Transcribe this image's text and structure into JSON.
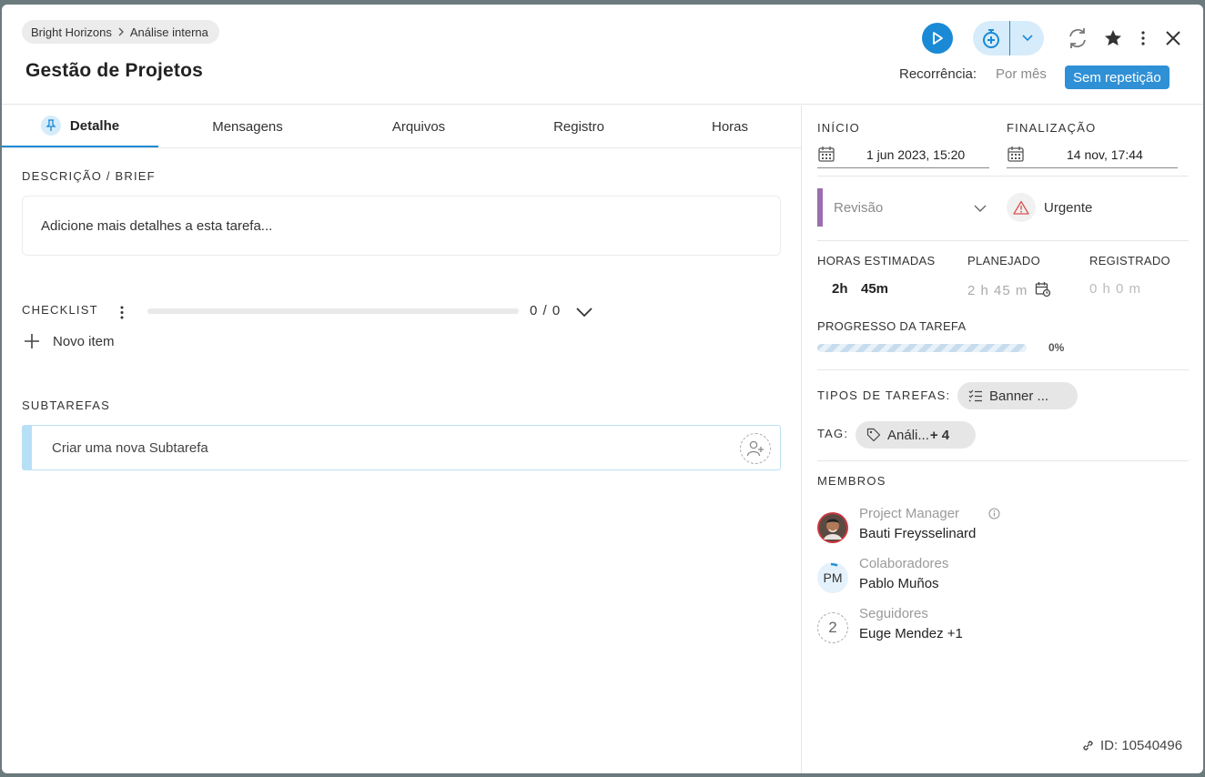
{
  "breadcrumb": {
    "workspace": "Bright Horizons",
    "project": "Análise interna"
  },
  "title": "Gestão de Projetos",
  "recurrence": {
    "label": "Recorrência:",
    "value": "Por mês",
    "badge": "Sem repetição"
  },
  "tabs": [
    "Detalhe",
    "Mensagens",
    "Arquivos",
    "Registro",
    "Horas"
  ],
  "description": {
    "label": "DESCRIÇÃO / BRIEF",
    "placeholder": "Adicione mais detalhes a esta tarefa..."
  },
  "checklist": {
    "label": "CHECKLIST",
    "count": "0 / 0",
    "progress": 0,
    "new_item": "Novo item"
  },
  "subtasks": {
    "label": "SUBTAREFAS",
    "placeholder": "Criar uma nova Subtarefa"
  },
  "dates": {
    "start_label": "INÍCIO",
    "start_value": "1 jun 2023, 15:20",
    "end_label": "FINALIZAÇÃO",
    "end_value": "14 nov, 17:44"
  },
  "status": {
    "value": "Revisão",
    "color": "#9a6fb0"
  },
  "priority": {
    "value": "Urgente",
    "color": "#d9534f"
  },
  "hours": {
    "estimated_label": "HORAS ESTIMADAS",
    "estimated_h": "2h",
    "estimated_m": "45m",
    "planned_label": "PLANEJADO",
    "planned_value": "2 h 45 m",
    "logged_label": "REGISTRADO",
    "logged_value": "0 h 0 m"
  },
  "task_progress": {
    "label": "PROGRESSO DA TAREFA",
    "value": "0%",
    "fraction": 0
  },
  "task_types": {
    "label": "TIPOS DE TAREFAS:",
    "value": "Banner ..."
  },
  "tags": {
    "label": "TAG:",
    "value": "Análi...",
    "more": "+ 4"
  },
  "members": {
    "label": "MEMBROS",
    "items": [
      {
        "role": "Project Manager",
        "name": "Bauti Freysselinard"
      },
      {
        "role": "Colaboradores",
        "name": "Pablo Muños",
        "initials": "PM"
      },
      {
        "role": "Seguidores",
        "name": "Euge Mendez +1",
        "count": "2"
      }
    ]
  },
  "id_text": "ID: 10540496",
  "accent_color": "#1a8ad6"
}
